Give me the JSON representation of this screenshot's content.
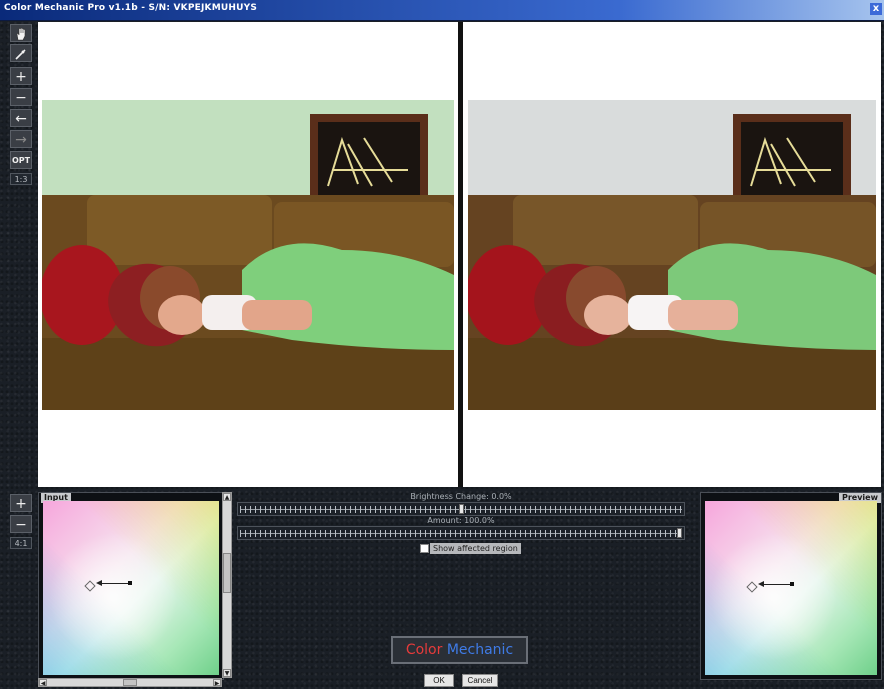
{
  "window": {
    "title": "Color Mechanic Pro v1.1b - S/N: VKPEJKMUHUYS",
    "close_label": "x"
  },
  "toolbar": {
    "hand_icon": "hand-icon",
    "picker_icon": "eyedropper-icon",
    "zoom_in_label": "+",
    "zoom_out_label": "−",
    "undo_label": "←",
    "redo_label": "→",
    "opt_label": "OPT",
    "zoom_ratio": "1:3"
  },
  "panes": {
    "left": "original",
    "right": "preview"
  },
  "color_toolbar": {
    "zoom_in_label": "+",
    "zoom_out_label": "−",
    "zoom_ratio": "4:1"
  },
  "input_box": {
    "label": "Input"
  },
  "preview_box": {
    "label": "Preview"
  },
  "sliders": {
    "brightness": {
      "label": "Brightness Change: 0.0%",
      "value": 0.5
    },
    "amount": {
      "label": "Amount: 100.0%",
      "value": 1.0
    }
  },
  "show_affected": {
    "label": "Show affected region",
    "checked": false
  },
  "logo": {
    "word1": "Color",
    "word2": "Mechanic"
  },
  "buttons": {
    "ok": "OK",
    "cancel": "Cancel"
  },
  "colors": {
    "accent_red": "#e63b3b",
    "accent_blue": "#3f7be6",
    "titlebar": "#0a2a7a"
  }
}
